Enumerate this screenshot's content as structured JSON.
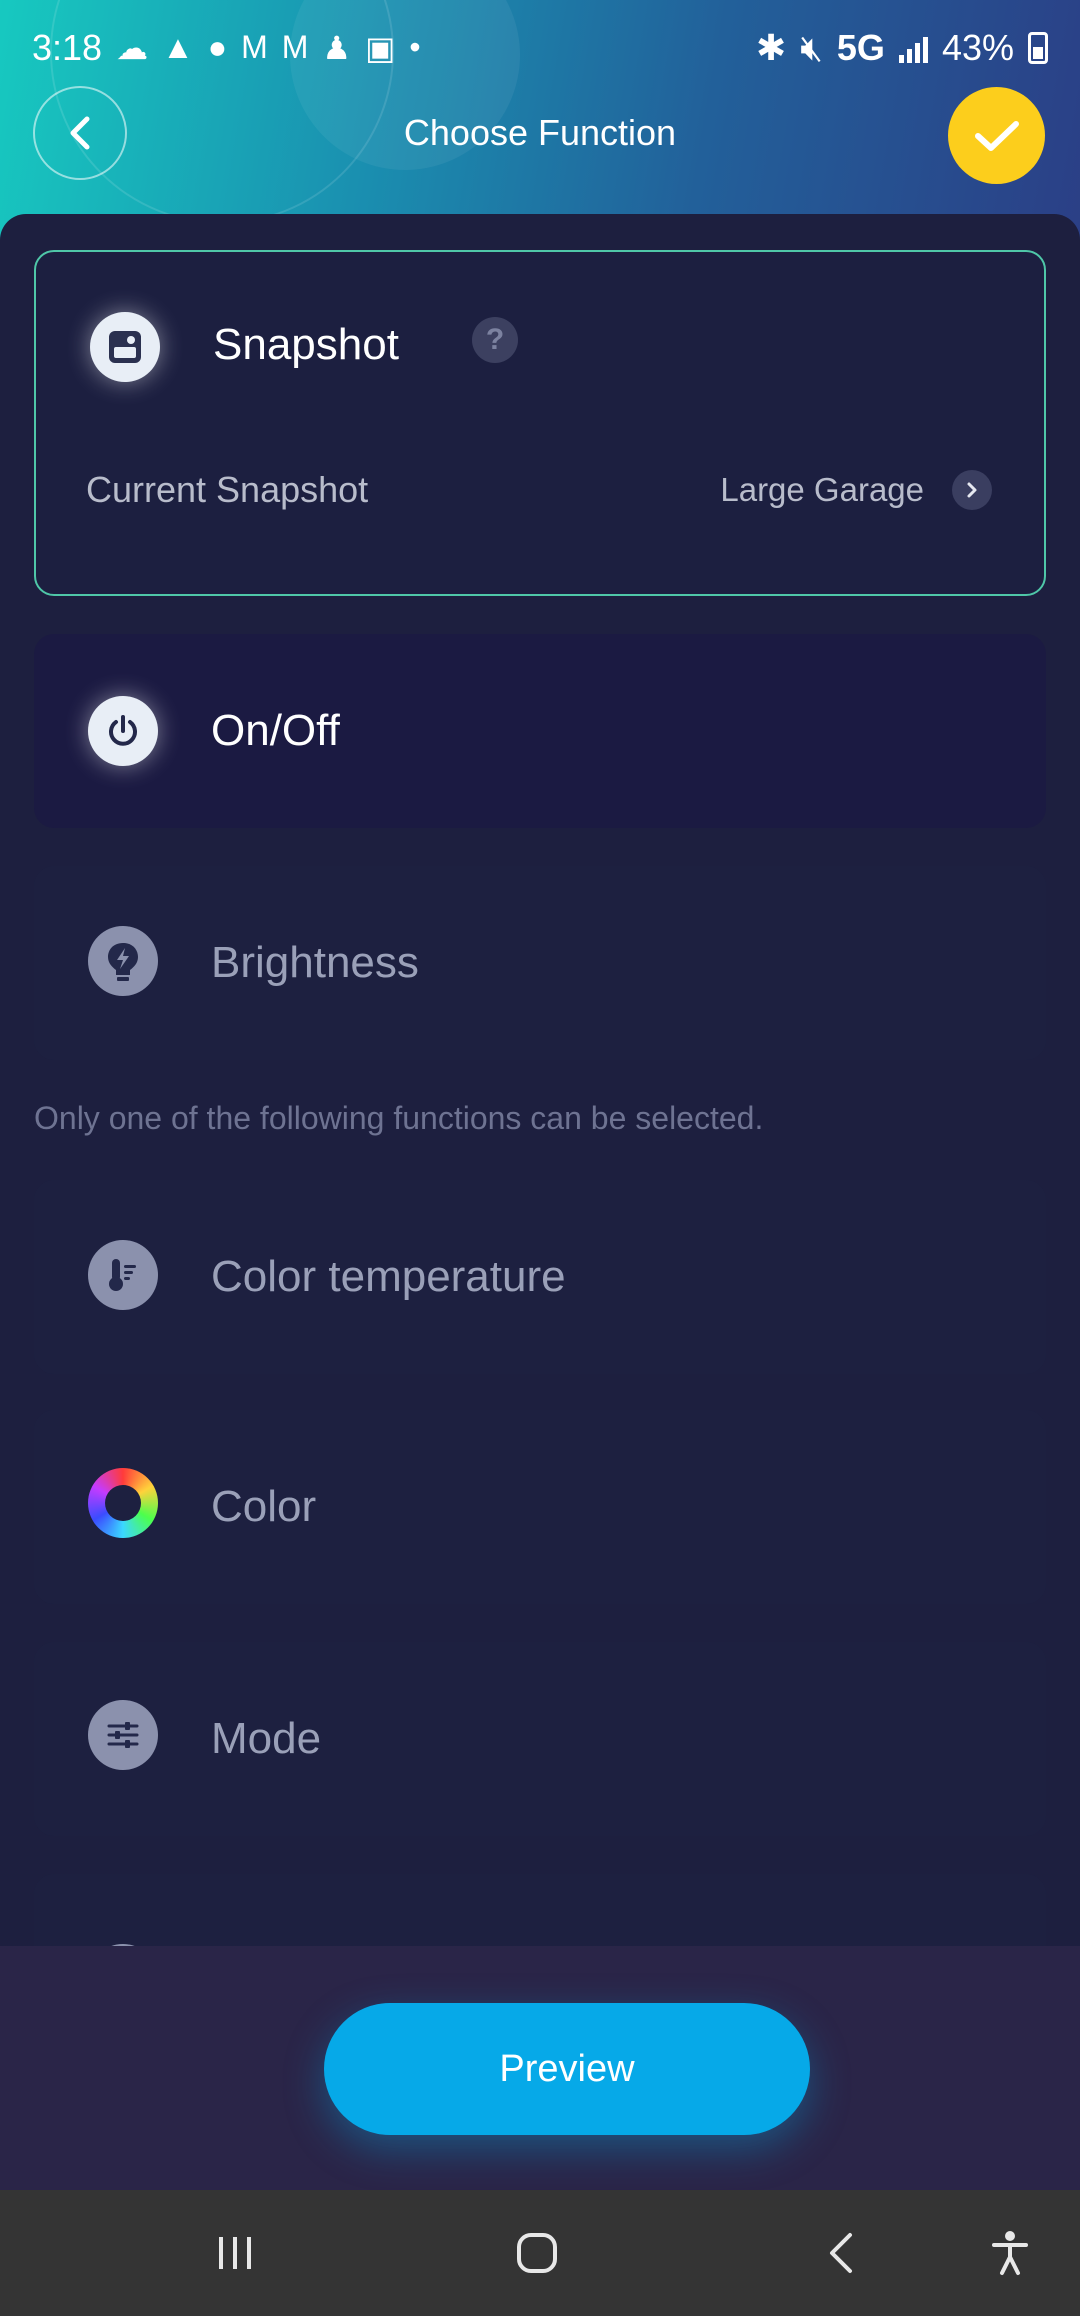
{
  "status_bar": {
    "time": "3:18",
    "network": "5G",
    "battery": "43%",
    "notification_icons": [
      "cloud-icon",
      "navigation-icon",
      "reddit-icon",
      "gmail-icon",
      "gmail-icon",
      "app-icon",
      "folder-icon",
      "dot-icon"
    ],
    "system_icons": [
      "bluetooth-icon",
      "mute-icon",
      "signal-icon",
      "battery-icon"
    ]
  },
  "header": {
    "title": "Choose Function",
    "confirm_color": "#fcce1c"
  },
  "snapshot_card": {
    "label": "Snapshot",
    "help": "?",
    "current_label": "Current Snapshot",
    "current_value": "Large Garage",
    "selected": true
  },
  "functions": [
    {
      "id": "onoff",
      "label": "On/Off",
      "icon": "power-icon",
      "enabled": true
    },
    {
      "id": "brightness",
      "label": "Brightness",
      "icon": "bulb-icon",
      "enabled": false
    }
  ],
  "note": "Only one of the following functions can be selected.",
  "exclusive_functions": [
    {
      "id": "color-temperature",
      "label": "Color temperature",
      "icon": "thermometer-icon"
    },
    {
      "id": "color",
      "label": "Color",
      "icon": "color-wheel-icon"
    },
    {
      "id": "mode",
      "label": "Mode",
      "icon": "sliders-icon"
    }
  ],
  "preview_button": {
    "label": "Preview",
    "color": "#06a9e8"
  },
  "nav_bar": [
    "recents-icon",
    "home-icon",
    "back-icon",
    "accessibility-icon"
  ]
}
